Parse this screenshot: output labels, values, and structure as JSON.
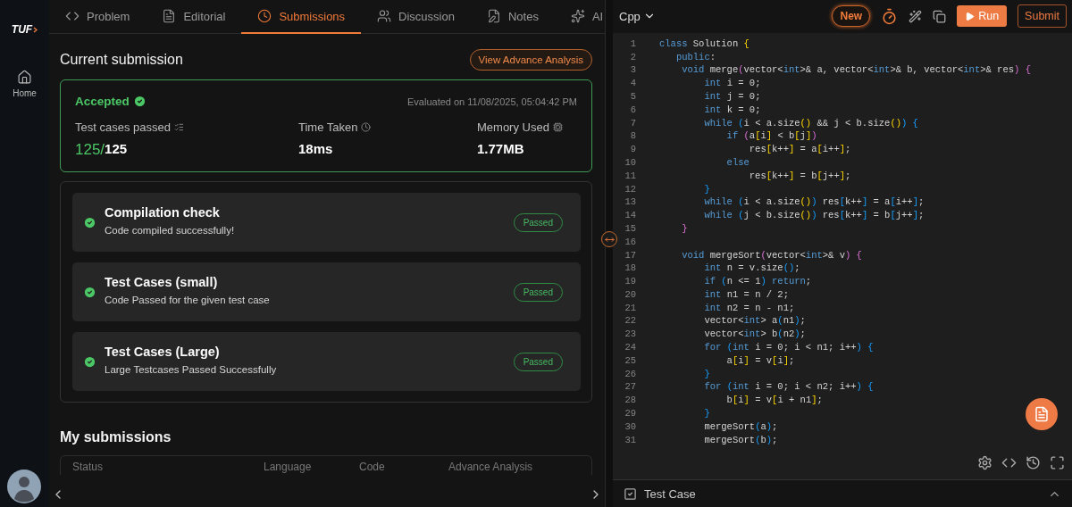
{
  "sidebar": {
    "logo": "TUF",
    "items": [
      {
        "label": "Home",
        "kind": "home",
        "selected": false
      }
    ]
  },
  "tabs": [
    {
      "label": "Problem",
      "kind": "code",
      "selected": false
    },
    {
      "label": "Editorial",
      "kind": "document",
      "selected": false
    },
    {
      "label": "Submissions",
      "kind": "clock",
      "selected": true
    },
    {
      "label": "Discussion",
      "kind": "people",
      "selected": false
    },
    {
      "label": "Notes",
      "kind": "note",
      "selected": false
    },
    {
      "label": "AI",
      "kind": "sparkle",
      "selected": false
    }
  ],
  "current_submission": {
    "title": "Current submission",
    "analysis_button": "View Advance Analysis",
    "status": "Accepted",
    "evaluated": "Evaluated on 11/08/2025, 05:04:42 PM",
    "stats": [
      {
        "label": "Test cases passed",
        "kind": "list",
        "value_highlight": "125/",
        "value": "125"
      },
      {
        "label": "Time Taken",
        "kind": "clock",
        "value": "18ms"
      },
      {
        "label": "Memory Used",
        "kind": "chip",
        "value": "1.77MB"
      }
    ]
  },
  "checks": [
    {
      "title": "Compilation check",
      "description": "Code compiled successfully!",
      "badge": "Passed"
    },
    {
      "title": "Test Cases (small)",
      "description": "Code Passed for the given test case",
      "badge": "Passed"
    },
    {
      "title": "Test Cases (Large)",
      "description": "Large Testcases Passed Successfully",
      "badge": "Passed"
    }
  ],
  "my_submissions": {
    "title": "My submissions",
    "columns": [
      "Status",
      "Language",
      "Code",
      "Advance Analysis"
    ]
  },
  "editor": {
    "language": "Cpp",
    "new_button": "New",
    "run_button": "Run",
    "submit_button": "Submit",
    "lines": [
      {
        "number": "1",
        "code": [
          {
            "text": "class ",
            "kind": "k"
          },
          {
            "text": "Solution ",
            "kind": "t"
          },
          {
            "text": "{",
            "kind": "y"
          }
        ]
      },
      {
        "number": "2",
        "code": [
          {
            "text": "   public",
            "kind": "k"
          },
          {
            "text": ":",
            "kind": "t"
          }
        ]
      },
      {
        "number": "3",
        "code": [
          {
            "text": "    void ",
            "kind": "k"
          },
          {
            "text": "merge",
            "kind": "t"
          },
          {
            "text": "(",
            "kind": "m"
          },
          {
            "text": "vector<",
            "kind": "t"
          },
          {
            "text": "int",
            "kind": "k"
          },
          {
            "text": ">& a, vector<",
            "kind": "t"
          },
          {
            "text": "int",
            "kind": "k"
          },
          {
            "text": ">& b, vector<",
            "kind": "t"
          },
          {
            "text": "int",
            "kind": "k"
          },
          {
            "text": ">& res",
            "kind": "t"
          },
          {
            "text": ") {",
            "kind": "m"
          }
        ]
      },
      {
        "number": "4",
        "code": [
          {
            "text": "        int ",
            "kind": "k"
          },
          {
            "text": "i = 0;",
            "kind": "t"
          }
        ]
      },
      {
        "number": "5",
        "code": [
          {
            "text": "        int ",
            "kind": "k"
          },
          {
            "text": "j = 0;",
            "kind": "t"
          }
        ]
      },
      {
        "number": "6",
        "code": [
          {
            "text": "        int ",
            "kind": "k"
          },
          {
            "text": "k = 0;",
            "kind": "t"
          }
        ]
      },
      {
        "number": "7",
        "code": [
          {
            "text": "        while ",
            "kind": "k"
          },
          {
            "text": "(",
            "kind": "b"
          },
          {
            "text": "i < a.size",
            "kind": "t"
          },
          {
            "text": "()",
            "kind": "y"
          },
          {
            "text": " && j < b.size",
            "kind": "t"
          },
          {
            "text": "()",
            "kind": "y"
          },
          {
            "text": ") {",
            "kind": "b"
          }
        ]
      },
      {
        "number": "8",
        "code": [
          {
            "text": "            if ",
            "kind": "k"
          },
          {
            "text": "(",
            "kind": "m"
          },
          {
            "text": "a",
            "kind": "t"
          },
          {
            "text": "[",
            "kind": "y"
          },
          {
            "text": "i",
            "kind": "t"
          },
          {
            "text": "]",
            "kind": "y"
          },
          {
            "text": " < b",
            "kind": "t"
          },
          {
            "text": "[",
            "kind": "y"
          },
          {
            "text": "j",
            "kind": "t"
          },
          {
            "text": "]",
            "kind": "y"
          },
          {
            "text": ")",
            "kind": "m"
          }
        ]
      },
      {
        "number": "9",
        "code": [
          {
            "text": "                res",
            "kind": "t"
          },
          {
            "text": "[",
            "kind": "y"
          },
          {
            "text": "k++",
            "kind": "t"
          },
          {
            "text": "]",
            "kind": "y"
          },
          {
            "text": " = a",
            "kind": "t"
          },
          {
            "text": "[",
            "kind": "y"
          },
          {
            "text": "i++",
            "kind": "t"
          },
          {
            "text": "]",
            "kind": "y"
          },
          {
            "text": ";",
            "kind": "t"
          }
        ]
      },
      {
        "number": "10",
        "code": [
          {
            "text": "            else",
            "kind": "k"
          }
        ]
      },
      {
        "number": "11",
        "code": [
          {
            "text": "                res",
            "kind": "t"
          },
          {
            "text": "[",
            "kind": "y"
          },
          {
            "text": "k++",
            "kind": "t"
          },
          {
            "text": "]",
            "kind": "y"
          },
          {
            "text": " = b",
            "kind": "t"
          },
          {
            "text": "[",
            "kind": "y"
          },
          {
            "text": "j++",
            "kind": "t"
          },
          {
            "text": "]",
            "kind": "y"
          },
          {
            "text": ";",
            "kind": "t"
          }
        ]
      },
      {
        "number": "12",
        "code": [
          {
            "text": "        }",
            "kind": "b"
          }
        ]
      },
      {
        "number": "13",
        "code": [
          {
            "text": "        while ",
            "kind": "k"
          },
          {
            "text": "(",
            "kind": "b"
          },
          {
            "text": "i < a.size",
            "kind": "t"
          },
          {
            "text": "()",
            "kind": "y"
          },
          {
            "text": ")",
            "kind": "b"
          },
          {
            "text": " res",
            "kind": "t"
          },
          {
            "text": "[",
            "kind": "b"
          },
          {
            "text": "k++",
            "kind": "t"
          },
          {
            "text": "]",
            "kind": "b"
          },
          {
            "text": " = a",
            "kind": "t"
          },
          {
            "text": "[",
            "kind": "b"
          },
          {
            "text": "i++",
            "kind": "t"
          },
          {
            "text": "]",
            "kind": "b"
          },
          {
            "text": ";",
            "kind": "t"
          }
        ]
      },
      {
        "number": "14",
        "code": [
          {
            "text": "        while ",
            "kind": "k"
          },
          {
            "text": "(",
            "kind": "b"
          },
          {
            "text": "j < b.size",
            "kind": "t"
          },
          {
            "text": "()",
            "kind": "y"
          },
          {
            "text": ")",
            "kind": "b"
          },
          {
            "text": " res",
            "kind": "t"
          },
          {
            "text": "[",
            "kind": "b"
          },
          {
            "text": "k++",
            "kind": "t"
          },
          {
            "text": "]",
            "kind": "b"
          },
          {
            "text": " = b",
            "kind": "t"
          },
          {
            "text": "[",
            "kind": "b"
          },
          {
            "text": "j++",
            "kind": "t"
          },
          {
            "text": "]",
            "kind": "b"
          },
          {
            "text": ";",
            "kind": "t"
          }
        ]
      },
      {
        "number": "15",
        "code": [
          {
            "text": "    }",
            "kind": "m"
          }
        ]
      },
      {
        "number": "16"
      },
      {
        "number": "17",
        "code": [
          {
            "text": "    void ",
            "kind": "k"
          },
          {
            "text": "mergeSort",
            "kind": "t"
          },
          {
            "text": "(",
            "kind": "m"
          },
          {
            "text": "vector<",
            "kind": "t"
          },
          {
            "text": "int",
            "kind": "k"
          },
          {
            "text": ">& v",
            "kind": "t"
          },
          {
            "text": ") {",
            "kind": "m"
          }
        ]
      },
      {
        "number": "18",
        "code": [
          {
            "text": "        int ",
            "kind": "k"
          },
          {
            "text": "n = v.size",
            "kind": "t"
          },
          {
            "text": "()",
            "kind": "b"
          },
          {
            "text": ";",
            "kind": "t"
          }
        ]
      },
      {
        "number": "19",
        "code": [
          {
            "text": "        if ",
            "kind": "k"
          },
          {
            "text": "(",
            "kind": "b"
          },
          {
            "text": "n <= 1",
            "kind": "t"
          },
          {
            "text": ")",
            "kind": "b"
          },
          {
            "text": " return",
            "kind": "k"
          },
          {
            "text": ";",
            "kind": "t"
          }
        ]
      },
      {
        "number": "20",
        "code": [
          {
            "text": "        int ",
            "kind": "k"
          },
          {
            "text": "n1 = n / 2;",
            "kind": "t"
          }
        ]
      },
      {
        "number": "21",
        "code": [
          {
            "text": "        int ",
            "kind": "k"
          },
          {
            "text": "n2 = n - n1;",
            "kind": "t"
          }
        ]
      },
      {
        "number": "22",
        "code": [
          {
            "text": "        vector<",
            "kind": "t"
          },
          {
            "text": "int",
            "kind": "k"
          },
          {
            "text": "> a",
            "kind": "t"
          },
          {
            "text": "(",
            "kind": "b"
          },
          {
            "text": "n1",
            "kind": "t"
          },
          {
            "text": ")",
            "kind": "b"
          },
          {
            "text": ";",
            "kind": "t"
          }
        ]
      },
      {
        "number": "23",
        "code": [
          {
            "text": "        vector<",
            "kind": "t"
          },
          {
            "text": "int",
            "kind": "k"
          },
          {
            "text": "> b",
            "kind": "t"
          },
          {
            "text": "(",
            "kind": "b"
          },
          {
            "text": "n2",
            "kind": "t"
          },
          {
            "text": ")",
            "kind": "b"
          },
          {
            "text": ";",
            "kind": "t"
          }
        ]
      },
      {
        "number": "24",
        "code": [
          {
            "text": "        for ",
            "kind": "k"
          },
          {
            "text": "(",
            "kind": "b"
          },
          {
            "text": "int ",
            "kind": "k"
          },
          {
            "text": "i = 0; i < n1; i++",
            "kind": "t"
          },
          {
            "text": ") {",
            "kind": "b"
          }
        ]
      },
      {
        "number": "25",
        "code": [
          {
            "text": "            a",
            "kind": "t"
          },
          {
            "text": "[",
            "kind": "y"
          },
          {
            "text": "i",
            "kind": "t"
          },
          {
            "text": "]",
            "kind": "y"
          },
          {
            "text": " = v",
            "kind": "t"
          },
          {
            "text": "[",
            "kind": "y"
          },
          {
            "text": "i",
            "kind": "t"
          },
          {
            "text": "]",
            "kind": "y"
          },
          {
            "text": ";",
            "kind": "t"
          }
        ]
      },
      {
        "number": "26",
        "code": [
          {
            "text": "        }",
            "kind": "b"
          }
        ]
      },
      {
        "number": "27",
        "code": [
          {
            "text": "        for ",
            "kind": "k"
          },
          {
            "text": "(",
            "kind": "b"
          },
          {
            "text": "int ",
            "kind": "k"
          },
          {
            "text": "i = 0; i < n2; i++",
            "kind": "t"
          },
          {
            "text": ") {",
            "kind": "b"
          }
        ]
      },
      {
        "number": "28",
        "code": [
          {
            "text": "            b",
            "kind": "t"
          },
          {
            "text": "[",
            "kind": "y"
          },
          {
            "text": "i",
            "kind": "t"
          },
          {
            "text": "]",
            "kind": "y"
          },
          {
            "text": " = v",
            "kind": "t"
          },
          {
            "text": "[",
            "kind": "y"
          },
          {
            "text": "i + n1",
            "kind": "t"
          },
          {
            "text": "]",
            "kind": "y"
          },
          {
            "text": ";",
            "kind": "t"
          }
        ]
      },
      {
        "number": "29",
        "code": [
          {
            "text": "        }",
            "kind": "b"
          }
        ]
      },
      {
        "number": "30",
        "code": [
          {
            "text": "        mergeSort",
            "kind": "t"
          },
          {
            "text": "(",
            "kind": "b"
          },
          {
            "text": "a",
            "kind": "t"
          },
          {
            "text": ")",
            "kind": "b"
          },
          {
            "text": ";",
            "kind": "t"
          }
        ]
      },
      {
        "number": "31",
        "code": [
          {
            "text": "        mergeSort",
            "kind": "t"
          },
          {
            "text": "(",
            "kind": "b"
          },
          {
            "text": "b",
            "kind": "t"
          },
          {
            "text": ")",
            "kind": "b"
          },
          {
            "text": ";",
            "kind": "t"
          }
        ]
      }
    ]
  },
  "test_case_bar": {
    "label": "Test Case"
  }
}
